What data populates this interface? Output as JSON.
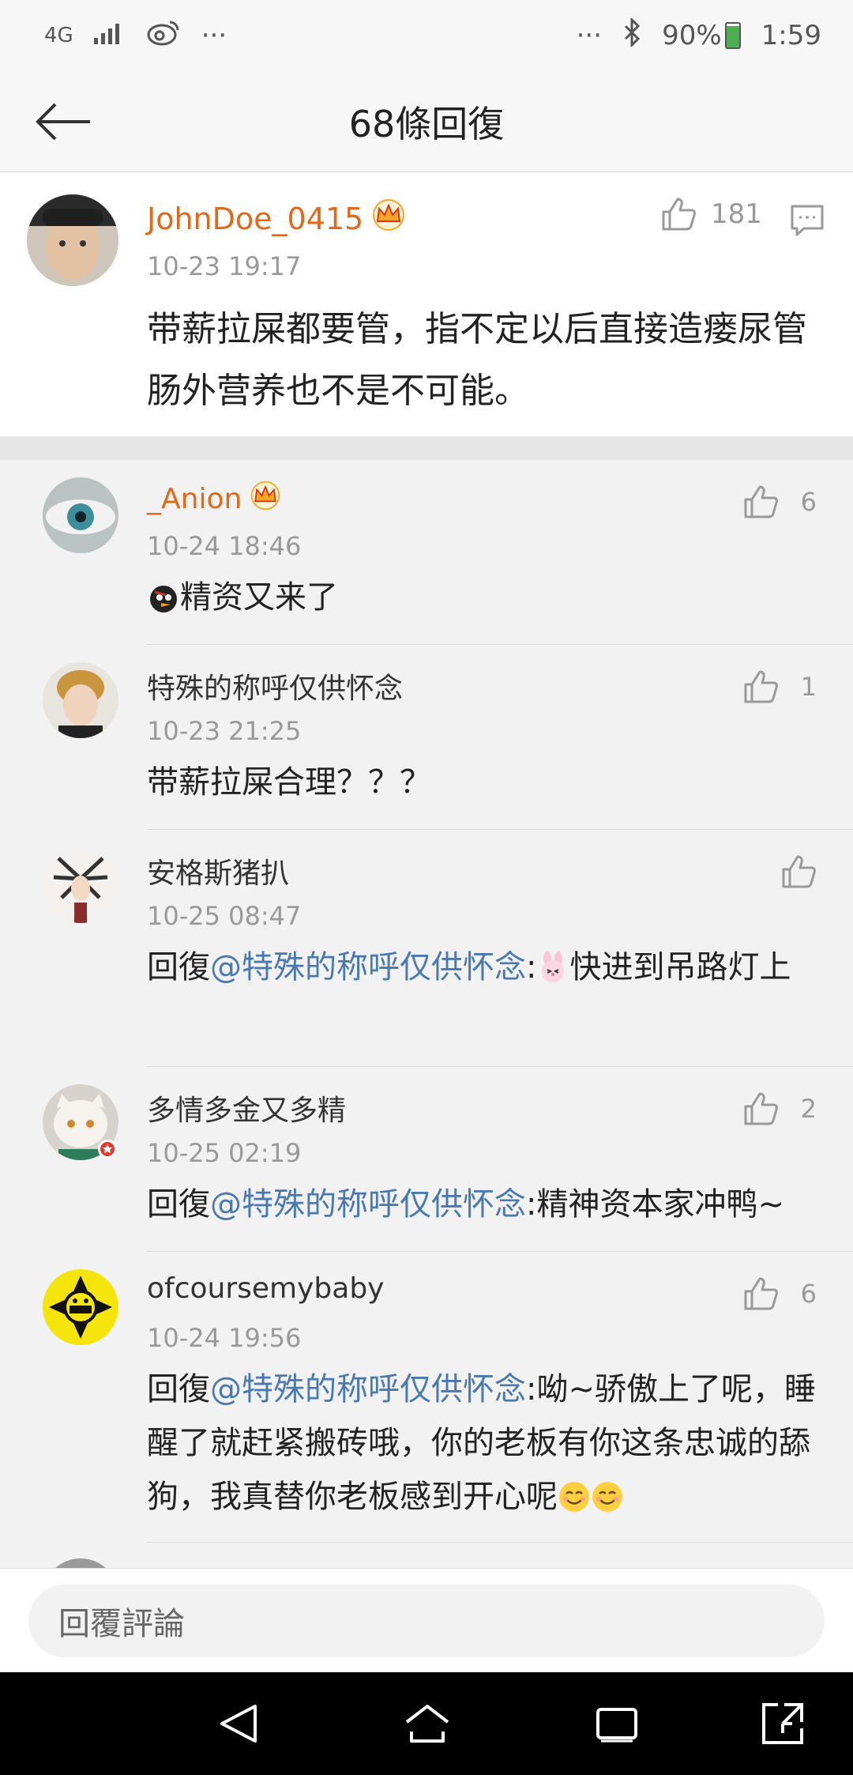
{
  "status_bar": {
    "network": "4G",
    "more_left": "···",
    "more_right": "···",
    "battery": "90%",
    "battery_level": 0.9,
    "time": "1:59"
  },
  "header": {
    "title": "68條回復"
  },
  "main_comment": {
    "user": "JohnDoe_0415",
    "time": "10-23 19:17",
    "text": "带薪拉屎都要管，指不定以后直接造瘘尿管肠外营养也不是不可能。",
    "likes": "181"
  },
  "replies": [
    {
      "user": "_Anion",
      "time": "10-24 18:46",
      "mention": "",
      "text": "精资又来了",
      "likes": "6"
    },
    {
      "user": "特殊的称呼仅供怀念",
      "time": "10-23 21:25",
      "mention": "",
      "text": "带薪拉屎合理？？？",
      "likes": "1"
    },
    {
      "user": "安格斯猪扒",
      "time": "10-25 08:47",
      "prefix": "回復",
      "mention": "@特殊的称呼仅供怀念",
      "text": "快进到吊路灯上",
      "likes": ""
    },
    {
      "user": "多情多金又多精",
      "time": "10-25 02:19",
      "prefix": "回復",
      "mention": "@特殊的称呼仅供怀念",
      "text": ":精神资本家冲鸭~",
      "likes": "2"
    },
    {
      "user": "ofcoursemybaby",
      "time": "10-24 19:56",
      "prefix": "回復",
      "mention": "@特殊的称呼仅供怀念",
      "text": ":呦~骄傲上了呢，睡醒了就赶紧搬砖哦，你的老板有你这条忠诚的舔狗，我真替你老板感到开心呢",
      "likes": "6"
    }
  ],
  "input": {
    "placeholder": "回覆評論"
  },
  "colors": {
    "name_orange": "#e06a1b",
    "mention_blue": "#4a79b1",
    "crown": "#f5a623"
  }
}
